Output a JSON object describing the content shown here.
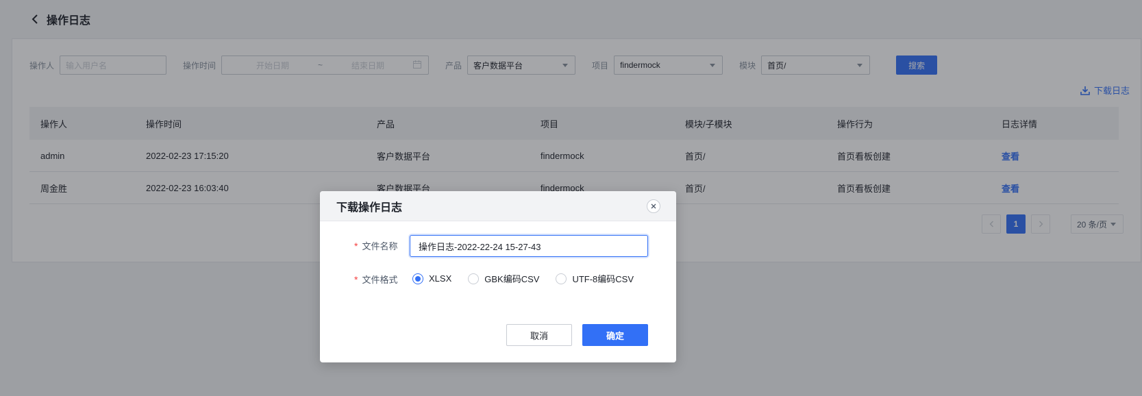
{
  "header": {
    "title": "操作日志",
    "back_icon": "chevron-left-icon"
  },
  "filters": {
    "operator_label": "操作人",
    "operator_placeholder": "输入用户名",
    "time_label": "操作时间",
    "start_placeholder": "开始日期",
    "range_separator": "~",
    "end_placeholder": "结束日期",
    "product_label": "产品",
    "product_value": "客户数据平台",
    "project_label": "项目",
    "project_value": "findermock",
    "module_label": "模块",
    "module_value": "首页/",
    "search_label": "搜索"
  },
  "download_link": {
    "label": "下载日志",
    "icon": "download-icon"
  },
  "table": {
    "columns": [
      "操作人",
      "操作时间",
      "产品",
      "项目",
      "模块/子模块",
      "操作行为",
      "日志详情"
    ],
    "rows": [
      [
        "admin",
        "2022-02-23 17:15:20",
        "客户数据平台",
        "findermock",
        "首页/",
        "首页看板创建",
        "查看"
      ],
      [
        "周金胜",
        "2022-02-23 16:03:40",
        "客户数据平台",
        "findermock",
        "首页/",
        "首页看板创建",
        "查看"
      ]
    ]
  },
  "pagination": {
    "current_page": "1",
    "page_size": "20 条/页"
  },
  "modal": {
    "title": "下载操作日志",
    "required_mark": "*",
    "file_name_label": "文件名称",
    "file_name_value": "操作日志-2022-22-24 15-27-43",
    "file_format_label": "文件格式",
    "formats": [
      "XLSX",
      "GBK编码CSV",
      "UTF-8编码CSV"
    ],
    "selected_format": "XLSX",
    "cancel_label": "取消",
    "confirm_label": "确定"
  },
  "colors": {
    "primary": "#3270f6",
    "required": "#f53f3f"
  }
}
